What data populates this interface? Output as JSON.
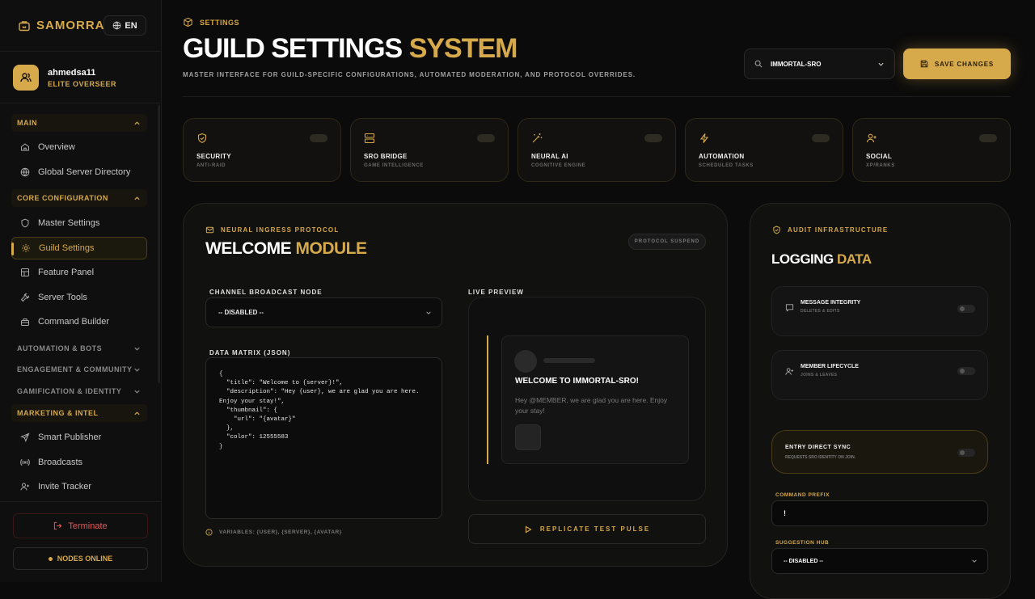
{
  "app": {
    "name": "SAMORRAY",
    "lang": "EN"
  },
  "user": {
    "name": "ahmedsa11",
    "role": "ELITE OVERSEER"
  },
  "sidebar": {
    "main_label": "MAIN",
    "overview": "Overview",
    "global_dir": "Global Server Directory",
    "core_label": "CORE CONFIGURATION",
    "master": "Master Settings",
    "guild": "Guild Settings",
    "feature": "Feature Panel",
    "tools": "Server Tools",
    "builder": "Command Builder",
    "auto_label": "AUTOMATION & BOTS",
    "engage_label": "ENGAGEMENT & COMMUNITY",
    "gamif_label": "GAMIFICATION & IDENTITY",
    "market_label": "MARKETING & INTEL",
    "publisher": "Smart Publisher",
    "broadcasts": "Broadcasts",
    "invite": "Invite Tracker",
    "terminate": "Terminate",
    "nodes": "NODES ONLINE"
  },
  "header": {
    "crumb": "SETTINGS",
    "title_a": "GUILD SETTINGS",
    "title_b": "SYSTEM",
    "subtitle": "MASTER INTERFACE FOR GUILD-SPECIFIC CONFIGURATIONS, AUTOMATED MODERATION, AND PROTOCOL OVERRIDES.",
    "guild": "IMMORTAL-SRO",
    "save": "SAVE CHANGES"
  },
  "features": [
    {
      "title": "SECURITY",
      "sub": "ANTI-RAID"
    },
    {
      "title": "SRO BRIDGE",
      "sub": "GAME INTELLIGENCE"
    },
    {
      "title": "NEURAL AI",
      "sub": "COGNITIVE ENGINE"
    },
    {
      "title": "AUTOMATION",
      "sub": "SCHEDULED TASKS"
    },
    {
      "title": "SOCIAL",
      "sub": "XP/RANKS"
    }
  ],
  "welcome": {
    "tag": "NEURAL INGRESS PROTOCOL",
    "title_a": "WELCOME",
    "title_b": "MODULE",
    "suspend": "PROTOCOL SUSPEND",
    "channel_label": "CHANNEL BROADCAST NODE",
    "channel_value": "-- DISABLED --",
    "json_label": "DATA MATRIX (JSON)",
    "json": "{\n  \"title\": \"Welcome to {server}!\",\n  \"description\": \"Hey {user}, we are glad you are here. Enjoy your stay!\",\n  \"thumbnail\": {\n    \"url\": \"{avatar}\"\n  },\n  \"color\": 12555583\n}",
    "vars": "VARIABLES: {USER}, {SERVER}, {AVATAR}",
    "preview_label": "LIVE PREVIEW",
    "preview_title": "WELCOME TO IMMORTAL-SRO!",
    "preview_desc": "Hey @MEMBER, we are glad you are here. Enjoy your stay!",
    "pulse": "REPLICATE TEST PULSE"
  },
  "logging": {
    "tag": "AUDIT INFRASTRUCTURE",
    "title_a": "LOGGING",
    "title_b": "DATA",
    "msg_title": "MESSAGE INTEGRITY",
    "msg_sub": "DELETES & EDITS",
    "life_title": "MEMBER LIFECYCLE",
    "life_sub": "JOINS & LEAVES",
    "sync_title": "ENTRY DIRECT SYNC",
    "sync_sub": "REQUESTS SRO IDENTITY ON JOIN.",
    "prefix_label": "COMMAND PREFIX",
    "prefix_value": "!",
    "hub_label": "SUGGESTION HUB",
    "hub_value": "-- DISABLED --"
  }
}
